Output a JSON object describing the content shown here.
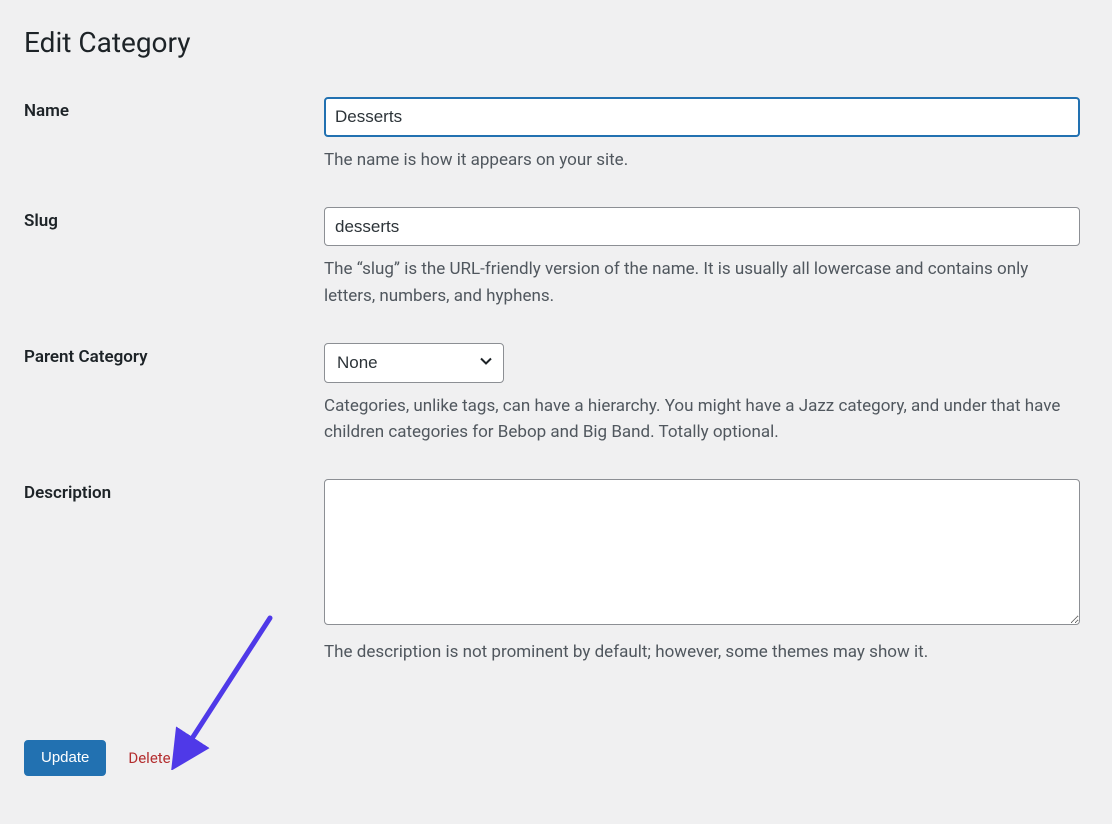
{
  "page": {
    "title": "Edit Category"
  },
  "fields": {
    "name": {
      "label": "Name",
      "value": "Desserts",
      "help": "The name is how it appears on your site."
    },
    "slug": {
      "label": "Slug",
      "value": "desserts",
      "help": "The “slug” is the URL-friendly version of the name. It is usually all lowercase and contains only letters, numbers, and hyphens."
    },
    "parent": {
      "label": "Parent Category",
      "selected": "None",
      "help": "Categories, unlike tags, can have a hierarchy. You might have a Jazz category, and under that have children categories for Bebop and Big Band. Totally optional."
    },
    "description": {
      "label": "Description",
      "value": "",
      "help": "The description is not prominent by default; however, some themes may show it."
    }
  },
  "actions": {
    "update": "Update",
    "delete": "Delete"
  },
  "annotation": {
    "arrow_color": "#4f39e8"
  }
}
